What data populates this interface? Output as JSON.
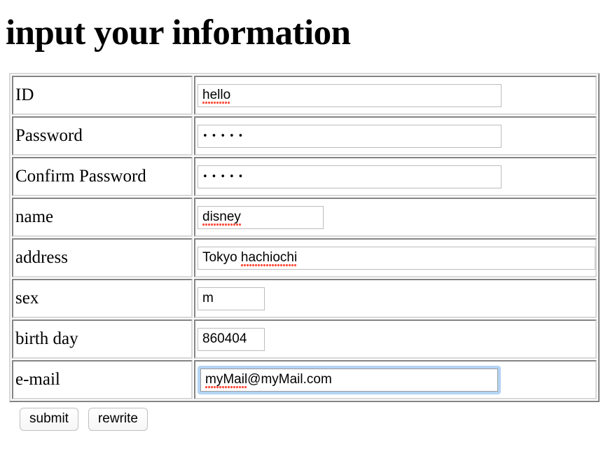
{
  "page": {
    "title": "input your information"
  },
  "form": {
    "rows": [
      {
        "label": "ID",
        "value": "hello",
        "field": "id-input",
        "width": "w-std",
        "type": "text",
        "misspelled": true,
        "focused": false
      },
      {
        "label": "Password",
        "value": "•••••",
        "field": "password-input",
        "width": "w-std",
        "type": "password",
        "misspelled": false,
        "focused": false
      },
      {
        "label": "Confirm Password",
        "value": "•••••",
        "field": "confirm-password-input",
        "width": "w-std",
        "type": "password",
        "misspelled": false,
        "focused": false
      },
      {
        "label": "name",
        "value": "disney",
        "field": "name-input",
        "width": "w-name",
        "type": "text",
        "misspelled": true,
        "focused": false
      },
      {
        "label": "address",
        "value": "Tokyo hachiochi",
        "field": "address-input",
        "width": "w-addr",
        "type": "text",
        "misspelled": true,
        "focused": false
      },
      {
        "label": "sex",
        "value": "m",
        "field": "sex-input",
        "width": "w-small",
        "type": "text",
        "misspelled": false,
        "focused": false
      },
      {
        "label": "birth day",
        "value": "860404",
        "field": "birthday-input",
        "width": "w-small",
        "type": "text",
        "misspelled": false,
        "focused": false
      },
      {
        "label": "e-mail",
        "value": "myMail@myMail.com",
        "field": "email-input",
        "width": "w-mail",
        "type": "text",
        "misspelled": true,
        "focused": true
      }
    ]
  },
  "buttons": {
    "submit_label": "submit",
    "rewrite_label": "rewrite"
  },
  "colors": {
    "focus_ring": "#b4d4f4",
    "spellcheck_underline": "#ff4d3d",
    "input_border": "#bdbdbd",
    "table_border": "#d8d8d8",
    "text": "#000000",
    "background": "#ffffff"
  }
}
